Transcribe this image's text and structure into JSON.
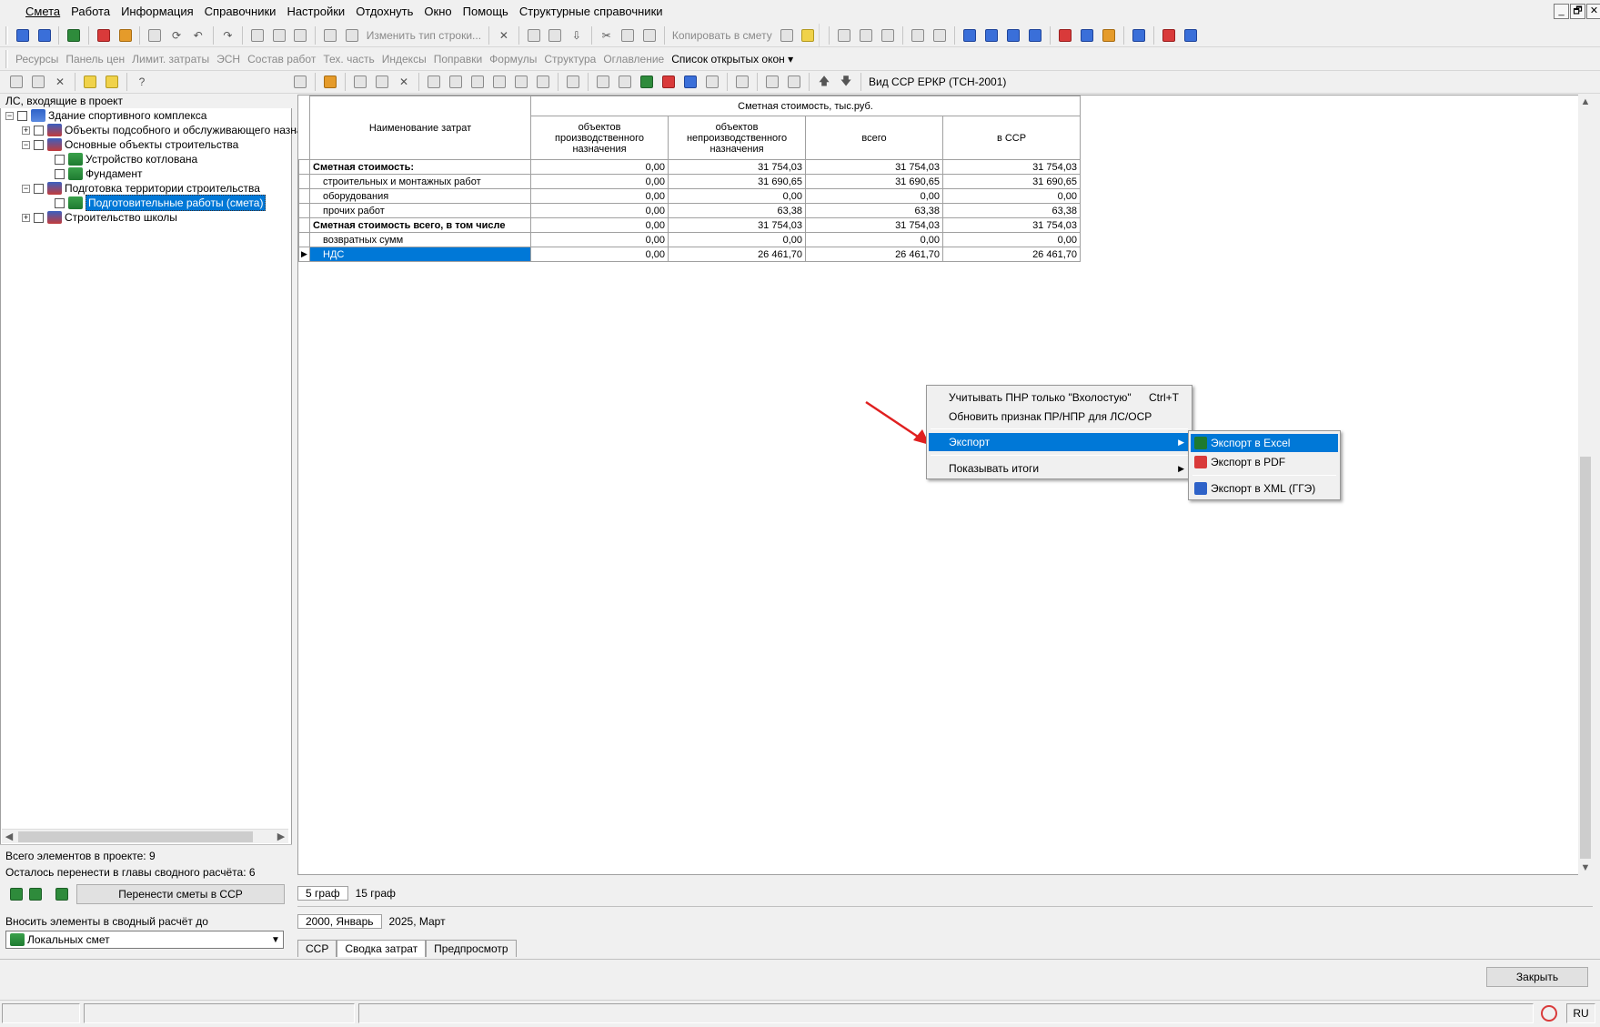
{
  "menubar": {
    "items": [
      "Смета",
      "Работа",
      "Информация",
      "Справочники",
      "Настройки",
      "Отдохнуть",
      "Окно",
      "Помощь",
      "Структурные справочники"
    ]
  },
  "window_controls": {
    "minimize": "_",
    "restore": "🗗",
    "close": "✕"
  },
  "toolbar1": {
    "change_row_type": "Изменить тип строки...",
    "copy_to_estimate": "Копировать в смету"
  },
  "toolbar2": {
    "items": [
      "Ресурсы",
      "Панель цен",
      "Лимит. затраты",
      "ЭСН",
      "Состав работ",
      "Тех. часть",
      "Индексы",
      "Поправки",
      "Формулы",
      "Структура",
      "Оглавление"
    ],
    "open_windows": "Список открытых окон"
  },
  "toolbar3": {
    "view_label": "Вид ССР ЕРКР (ТСН-2001)"
  },
  "left_panel": {
    "header": "ЛС, входящие в проект",
    "tree": [
      {
        "label": "Здание спортивного комплекса",
        "level": 0,
        "expander": "−",
        "icon": "building-icon"
      },
      {
        "label": "Объекты подсобного и обслуживающего назна",
        "level": 1,
        "expander": "+",
        "icon": "object-icon"
      },
      {
        "label": "Основные объекты строительства",
        "level": 1,
        "expander": "−",
        "icon": "object-icon"
      },
      {
        "label": "Устройство котлована",
        "level": 2,
        "expander": "",
        "icon": "estimate-book-icon"
      },
      {
        "label": "Фундамент",
        "level": 2,
        "expander": "",
        "icon": "estimate-book-icon"
      },
      {
        "label": "Подготовка территории строительства",
        "level": 1,
        "expander": "−",
        "icon": "object-icon"
      },
      {
        "label": "Подготовительные работы (смета)",
        "level": 2,
        "expander": "",
        "icon": "estimate-book-icon",
        "selected": true
      },
      {
        "label": "Строительство школы",
        "level": 1,
        "expander": "+",
        "icon": "object-icon"
      }
    ],
    "total_elements": "Всего элементов в проекте: 9",
    "remaining": "Осталось перенести в главы сводного расчёта: 6",
    "transfer_button": "Перенести сметы в ССР",
    "include_label": "Вносить элементы в сводный расчёт до",
    "include_select": "Локальных смет"
  },
  "grid": {
    "col_name": "Наименование затрат",
    "group_header": "Сметная стоимость, тыс.руб.",
    "cols": [
      "объектов производственного назначения",
      "объектов непроизводственного назначения",
      "всего",
      "в ССР"
    ],
    "rows": [
      {
        "name": "Сметная стоимость:",
        "bold": true,
        "sub": false,
        "values": [
          "0,00",
          "31 754,03",
          "31 754,03",
          "31 754,03"
        ]
      },
      {
        "name": "строительных и монтажных работ",
        "bold": false,
        "sub": true,
        "values": [
          "0,00",
          "31 690,65",
          "31 690,65",
          "31 690,65"
        ]
      },
      {
        "name": "оборудования",
        "bold": false,
        "sub": true,
        "values": [
          "0,00",
          "0,00",
          "0,00",
          "0,00"
        ]
      },
      {
        "name": "прочих работ",
        "bold": false,
        "sub": true,
        "values": [
          "0,00",
          "63,38",
          "63,38",
          "63,38"
        ]
      },
      {
        "name": "Сметная стоимость всего, в том числе",
        "bold": true,
        "sub": false,
        "values": [
          "0,00",
          "31 754,03",
          "31 754,03",
          "31 754,03"
        ]
      },
      {
        "name": "возвратных сумм",
        "bold": false,
        "sub": true,
        "values": [
          "0,00",
          "0,00",
          "0,00",
          "0,00"
        ]
      },
      {
        "name": "НДС",
        "bold": false,
        "sub": true,
        "selected": true,
        "values": [
          "0,00",
          "26 461,70",
          "26 461,70",
          "26 461,70"
        ]
      }
    ]
  },
  "context_menu": {
    "item1": "Учитывать ПНР только \"Вхолостую\"",
    "item1_shortcut": "Ctrl+T",
    "item2": "Обновить признак ПР/НПР для ЛС/ОСР",
    "export": "Экспорт",
    "show_totals": "Показывать итоги"
  },
  "export_submenu": {
    "excel": "Экспорт в Excel",
    "pdf": "Экспорт в PDF",
    "xml": "Экспорт в XML (ГГЭ)"
  },
  "graph_tabs": [
    "5 граф",
    "15 граф"
  ],
  "period_tabs": [
    "2000, Январь",
    "2025, Март"
  ],
  "bottom_tabs": [
    "ССР",
    "Сводка затрат",
    "Предпросмотр"
  ],
  "close_button": "Закрыть",
  "status": {
    "lang": "RU"
  },
  "colors": {
    "selection": "#0078d7",
    "arrow": "#e02020"
  }
}
